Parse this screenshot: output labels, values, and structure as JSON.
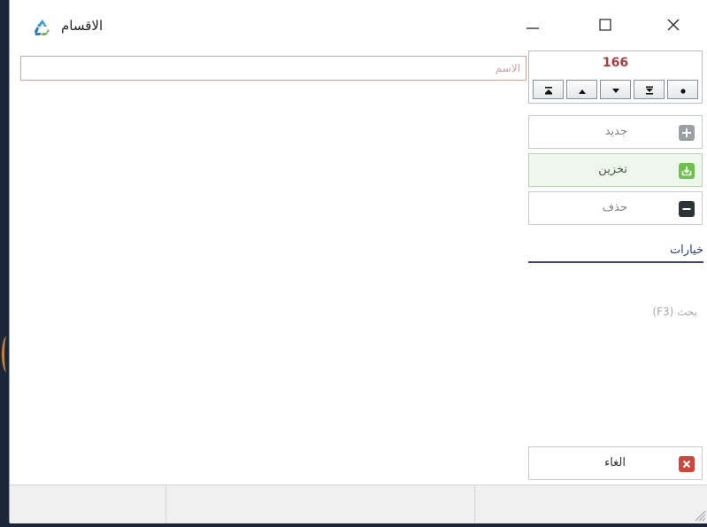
{
  "window": {
    "title": "الاقسام",
    "app_icon": "recycle-icon",
    "controls": [
      "minimize-icon",
      "maximize-icon",
      "close-icon"
    ]
  },
  "form": {
    "name_placeholder": "الاسم",
    "name_value": ""
  },
  "navigator": {
    "record_number": "166",
    "buttons": [
      "last-record-icon",
      "next-record-icon",
      "previous-record-icon",
      "first-record-icon",
      "new-record-dot-icon"
    ]
  },
  "actions": {
    "new_label": "جديد",
    "save_label": "تخزين",
    "delete_label": "حذف",
    "cancel_label": "الغاء"
  },
  "options": {
    "title": "خيارات",
    "search_label": "بحث (F3)"
  },
  "colors": {
    "record_number": "#b33a3a",
    "save_icon": "#6cc24a",
    "cancel_icon": "#d0453a",
    "options_accent": "#3a3f9c"
  }
}
